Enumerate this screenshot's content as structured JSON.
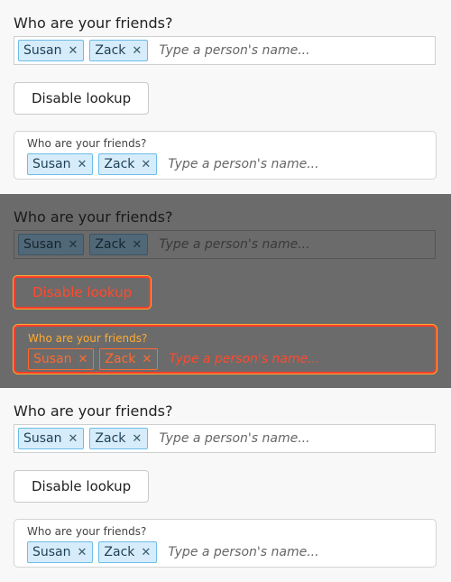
{
  "question": "Who are your friends?",
  "chips": [
    "Susan",
    "Zack"
  ],
  "remove_glyph": "✕",
  "placeholder": "Type a person's name...",
  "button_label": "Disable lookup",
  "card_label": "Who are your friends?",
  "colors": {
    "chip_bg": "#d6ecfb",
    "chip_border": "#6bbde6",
    "overlay_bg": "#6b6b6b",
    "highlight": "#ff3d2e"
  }
}
